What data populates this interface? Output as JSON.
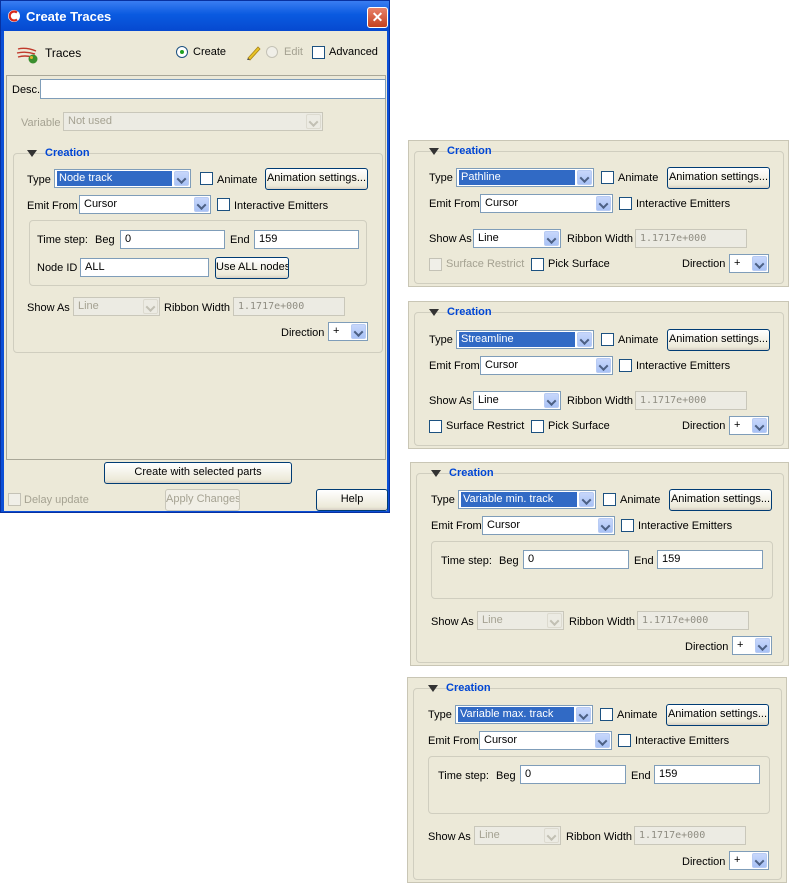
{
  "window": {
    "title": "Create Traces",
    "close_glyph": "✕"
  },
  "header": {
    "traces_label": "Traces",
    "mode_create": "Create",
    "mode_edit": "Edit",
    "advanced_label": "Advanced",
    "create_selected": true
  },
  "desc": {
    "label": "Desc.",
    "value": ""
  },
  "variable": {
    "label": "Variable",
    "value": "Not used"
  },
  "labels": {
    "creation": "Creation",
    "type": "Type",
    "animate": "Animate",
    "animation_settings": "Animation settings...",
    "emit_from": "Emit From",
    "interactive_emitters": "Interactive Emitters",
    "time_step": "Time step:",
    "beg": "Beg",
    "end": "End",
    "node_id": "Node ID",
    "use_all_nodes": "Use ALL nodes",
    "show_as": "Show As",
    "ribbon_width": "Ribbon Width",
    "direction": "Direction",
    "surface_restrict": "Surface Restrict",
    "pick_surface": "Pick Surface"
  },
  "main_panel": {
    "type_value": "Node track",
    "emit_value": "Cursor",
    "beg_value": "0",
    "end_value": "159",
    "node_id_value": "ALL",
    "show_as_value": "Line",
    "ribbon_value": "1.1717e+000",
    "direction_value": "+"
  },
  "footer": {
    "create_with_selected": "Create with selected parts",
    "delay_update": "Delay update",
    "apply_changes": "Apply Changes",
    "help": "Help"
  },
  "variants": [
    {
      "type_value": "Pathline",
      "emit_value": "Cursor",
      "show_as_value": "Line",
      "ribbon_value": "1.1717e+000",
      "direction_value": "+"
    },
    {
      "type_value": "Streamline",
      "emit_value": "Cursor",
      "show_as_value": "Line",
      "ribbon_value": "1.1717e+000",
      "direction_value": "+"
    },
    {
      "type_value": "Variable min. track",
      "emit_value": "Cursor",
      "beg_value": "0",
      "end_value": "159",
      "show_as_value": "Line",
      "ribbon_value": "1.1717e+000",
      "direction_value": "+"
    },
    {
      "type_value": "Variable max. track",
      "emit_value": "Cursor",
      "beg_value": "0",
      "end_value": "159",
      "show_as_value": "Line",
      "ribbon_value": "1.1717e+000",
      "direction_value": "+"
    }
  ]
}
